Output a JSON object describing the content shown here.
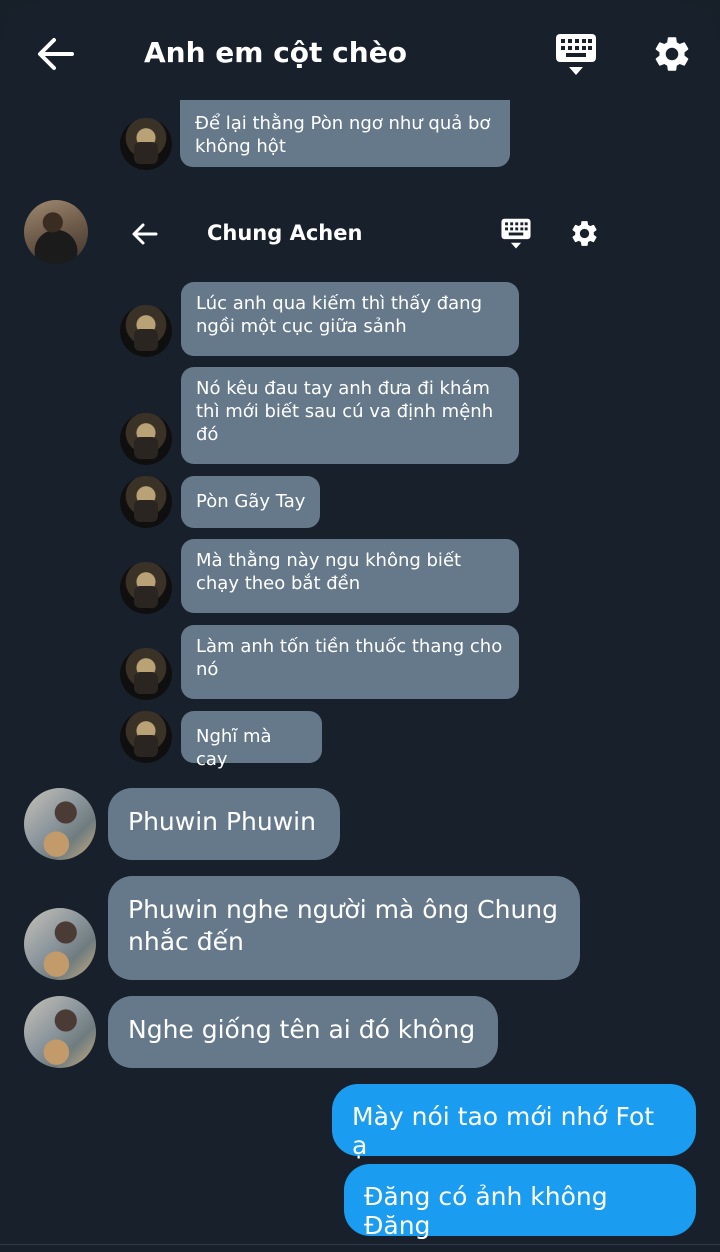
{
  "header": {
    "title": "Anh em cột chèo"
  },
  "inner_header": {
    "title": "Chung Achen"
  },
  "icons": {
    "back": "arrow-left-icon",
    "keyboard": "keyboard-icon",
    "settings": "gear-icon"
  },
  "top_partial_message": {
    "text": "Để lại thằng Pòn ngơ như quả bơ không hột"
  },
  "inner_messages": [
    {
      "text": "Lúc anh qua kiếm thì thấy đang ngồi một cục giữa sảnh"
    },
    {
      "text": "Nó kêu đau tay anh đưa đi khám thì mới biết sau cú va định mệnh đó"
    },
    {
      "text": "Pòn Gãy Tay"
    },
    {
      "text": "Mà thằng này ngu không biết chạy theo bắt đền"
    },
    {
      "text": "Làm anh tốn tiền thuốc thang cho nó"
    },
    {
      "text": "Nghĩ mà cay"
    }
  ],
  "messages": [
    {
      "text": "Phuwin Phuwin"
    },
    {
      "text": "Phuwin nghe người mà ông Chung nhắc đến"
    },
    {
      "text": "Nghe giống tên ai đó không"
    }
  ],
  "my_messages": [
    {
      "text": "Mày nói tao mới nhớ Fot ạ"
    },
    {
      "text": "Đăng có ảnh không Đăng"
    }
  ],
  "colors": {
    "background": "#18212b",
    "bubble_incoming": "#66798b",
    "bubble_outgoing": "#1a9cf0"
  }
}
